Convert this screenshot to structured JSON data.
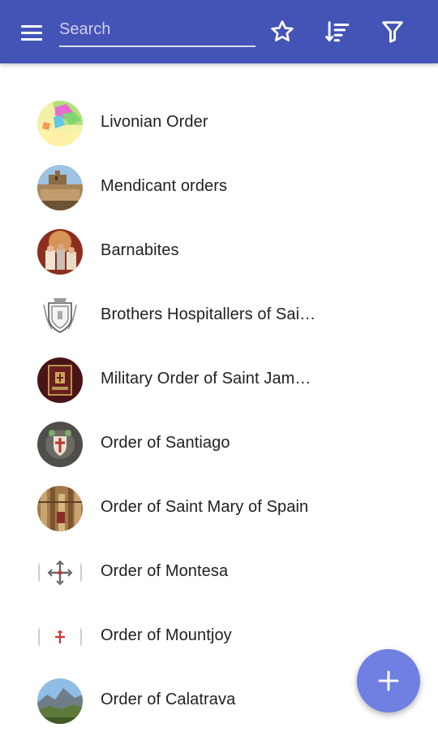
{
  "toolbar": {
    "search_placeholder": "Search",
    "icons": {
      "menu": "menu-icon",
      "favorites": "star-outline-icon",
      "sort": "sort-icon",
      "filter": "filter-icon"
    },
    "background": "#4453b6"
  },
  "list": {
    "items": [
      {
        "label": "Livonian Order",
        "thumb": "map-image"
      },
      {
        "label": "Mendicant orders",
        "thumb": "building-photo"
      },
      {
        "label": "Barnabites",
        "thumb": "painting-photo"
      },
      {
        "label": "Brothers Hospitallers of Sai…",
        "thumb": "coat-of-arms"
      },
      {
        "label": "Military Order of Saint Jam…",
        "thumb": "banner-photo"
      },
      {
        "label": "Order of Santiago",
        "thumb": "emblem-photo"
      },
      {
        "label": "Order of Saint Mary of Spain",
        "thumb": "church-interior-photo"
      },
      {
        "label": "Order of Montesa",
        "thumb": "cross-emblem"
      },
      {
        "label": "Order of Mountjoy",
        "thumb": "red-cross-emblem"
      },
      {
        "label": "Order of Calatrava",
        "thumb": "mountain-photo"
      }
    ]
  },
  "fab": {
    "icon": "plus-icon",
    "color": "#6f7fe2"
  }
}
